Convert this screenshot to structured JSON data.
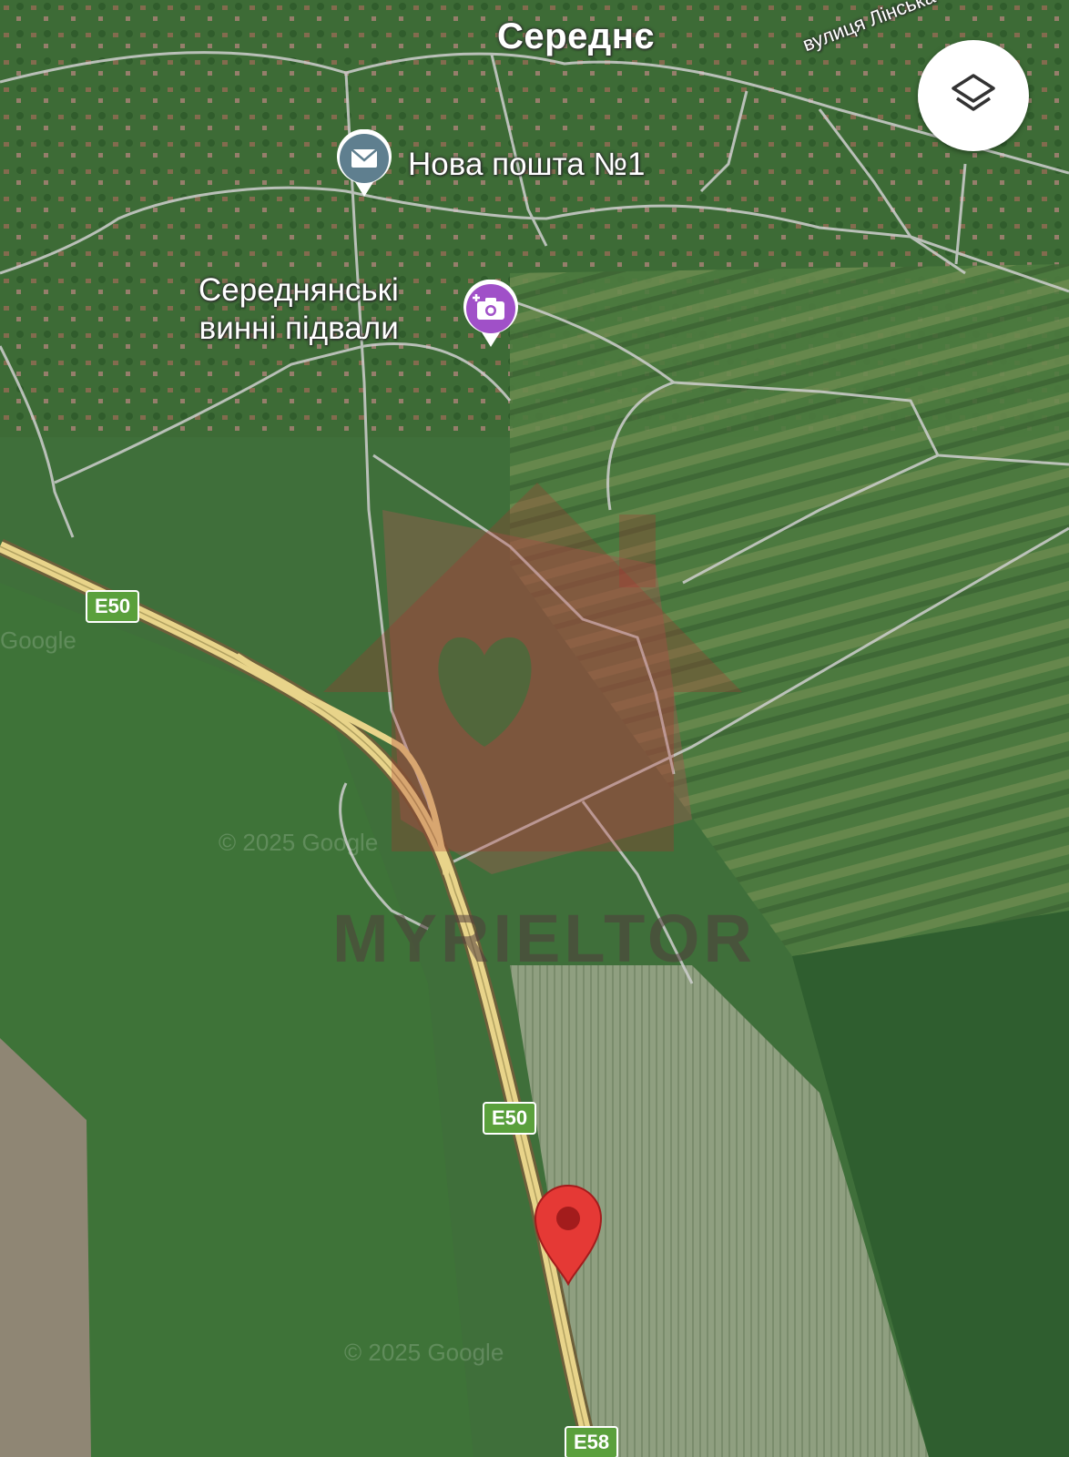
{
  "map": {
    "place_label": "Середнє",
    "street_label": "вулиця Лінська",
    "pois": [
      {
        "label": "Нова пошта №1",
        "icon": "mail-icon",
        "color": "#5f7f8f"
      },
      {
        "label": "Середнянські\nвинні підвали",
        "icon": "camera-plus-icon",
        "color": "#a050c8"
      }
    ],
    "road_shields": [
      "E50",
      "E50",
      "E58"
    ],
    "watermark": "MYRIELTOR",
    "copyright": [
      "© 2025 Google",
      "© 2025 Google",
      "Google"
    ],
    "layers_button_icon": "layers-icon",
    "marker_icon": "red-location-pin-icon",
    "colors": {
      "road_highway": "#e8d48a",
      "road_local": "#c9c9c9",
      "poi_post": "#5f7f8f",
      "poi_photo": "#a050c8",
      "marker": "#e53935"
    }
  }
}
